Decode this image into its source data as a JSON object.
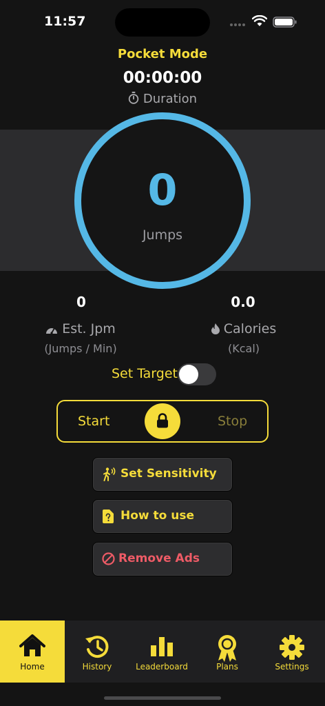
{
  "status_bar": {
    "time": "11:57"
  },
  "header": {
    "mode_title": "Pocket Mode",
    "timer": "00:00:00",
    "duration_label": "Duration"
  },
  "counter": {
    "value": "0",
    "label": "Jumps"
  },
  "stats": {
    "jpm": {
      "value": "0",
      "label": "Est. Jpm",
      "unit": "(Jumps / Min)"
    },
    "calories": {
      "value": "0.0",
      "label": "Calories",
      "unit": "(Kcal)"
    }
  },
  "target": {
    "label": "Set Target",
    "enabled": false
  },
  "controls": {
    "start_label": "Start",
    "stop_label": "Stop"
  },
  "actions": {
    "sensitivity": "Set Sensitivity",
    "how_to": "How to use",
    "remove_ads": "Remove Ads"
  },
  "tabs": [
    {
      "label": "Home",
      "icon": "home-icon",
      "active": true
    },
    {
      "label": "History",
      "icon": "history-icon",
      "active": false
    },
    {
      "label": "Leaderboard",
      "icon": "leaderboard-icon",
      "active": false
    },
    {
      "label": "Plans",
      "icon": "award-icon",
      "active": false
    },
    {
      "label": "Settings",
      "icon": "gear-icon",
      "active": false
    }
  ],
  "colors": {
    "accent": "#f5dc3a",
    "ring": "#55b8e6",
    "danger": "#ee5b66",
    "background": "#141414"
  }
}
